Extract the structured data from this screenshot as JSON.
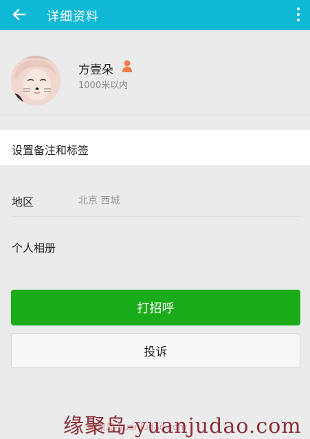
{
  "header": {
    "title": "详细资料",
    "back_icon": "arrow-left-icon",
    "more_icon": "more-vertical-icon",
    "color": "#0fb8d4"
  },
  "profile": {
    "name": "方壹朵",
    "distance": "1000米以内",
    "gender_icon": "female-icon"
  },
  "remark": {
    "label": "设置备注和标签"
  },
  "region": {
    "label": "地区",
    "value": "北京  西城"
  },
  "album": {
    "label": "个人相册"
  },
  "actions": {
    "greet_label": "打招呼",
    "greet_color": "#1aad19",
    "report_label": "投诉"
  },
  "watermark": {
    "main": "缘聚岛-yuanjudao.com",
    "small": "缘聚岛-yuanjudao.com"
  }
}
